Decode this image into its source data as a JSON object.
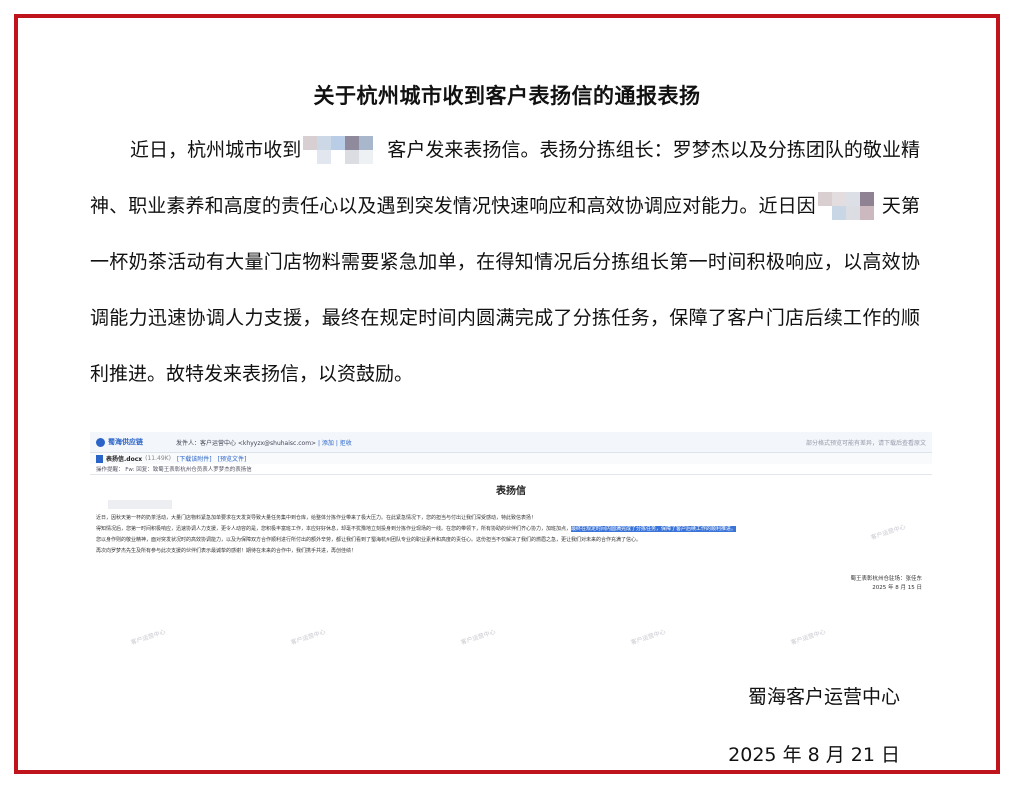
{
  "document": {
    "title": "关于杭州城市收到客户表扬信的通报表扬",
    "paragraph": {
      "p1": "近日，杭州城市收到",
      "p2": "客户发来表扬信。表扬分拣组长：罗梦杰以及分拣团队的敬业精神、职业素养和高度的责任心以及遇到突发情况快速响应和高效协调应对能力。近日因",
      "p3": "天第一杯奶茶活动有大量门店物料需要紧急加单，在得知情况后分拣组长第一时间积极响应，以高效协调能力迅速协调人力支援，最终在规定时间内圆满完成了分拣任务，保障了客户门店后续工作的顺利推进。故特发来表扬信，以资鼓励。"
    },
    "signature": "蜀海客户运营中心",
    "date": "2025 年 8 月 21 日"
  },
  "embedded_email": {
    "logo_text": "蜀海供应链",
    "sender_label": "发件人：客户运营中心 <khyyzx@shuhaisc.com>",
    "sender_links": [
      "| 添加",
      "| 拒收"
    ],
    "right_hint": "部分格式预览可能有差异，请下载后查看原文",
    "attachment_name": "表扬信.docx",
    "attachment_size": "(11.49K)",
    "attachment_links": [
      "[下载该附件]",
      "[预览文件]"
    ],
    "subject": "操作提醒：  Fw: 回复：致蜀王表彰杭州仓员表人罗梦杰的表扬信",
    "letter_title": "表扬信",
    "letter_lines": [
      "近日，因秋天第一杯的奶茶活动，大量门店物料紧急加单要求在天发货导致大量任务集中到仓库，给整体分拣作业带来了极大压力。在此紧急情况下，您的担当与付出让我们深受感动，特此致信表扬！",
      "得知情况后，您第一时间积极响应，迅速协调人力支援，更令人动容的是，您积极丰富班工作，本应好好休息，却毫不犹豫地立刻投身到分拣作业现场的一线。在您的带领下，所有协助的伙伴们齐心协力，加班加点，",
      "最终在规定时间内圆满完成了分拣任务，保障了客户后续工作的顺利推进。",
      "您以身作则的敬业精神，面对突发状况时的高效协调能力，以及为保障双方合作顺利进行所付出的额外辛劳，都让我们看到了蜀海杭州团队专业的职业素养和高度的责任心。这份担当不仅解决了我们的燃眉之急，更让我们对未来的合作充满了信心。",
      "再次向罗梦杰先生及所有参与此次支援的伙伴们表示最诚挚的感谢！期待在未来的合作中，我们携手共进，再创佳绩！"
    ],
    "letter_sign": "蜀王表彰杭州仓驻场：张佳东",
    "letter_date": "2025 年 8 月 15 日",
    "watermark": "客户运营中心"
  },
  "colors": {
    "frame_border": "#c0141c",
    "highlight": "#3b74d8"
  }
}
